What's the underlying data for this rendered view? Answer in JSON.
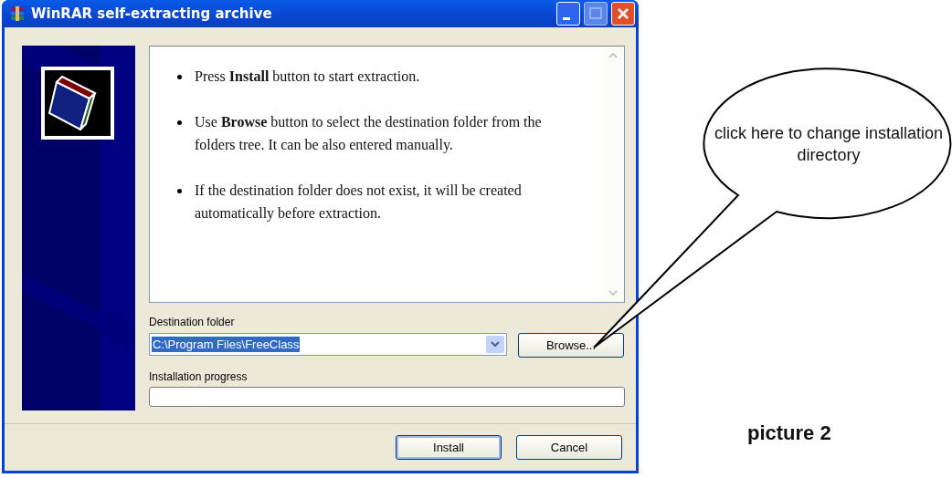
{
  "window": {
    "title": "WinRAR self-extracting archive"
  },
  "instructions": [
    {
      "text": "Press **Install** button to start extraction."
    },
    {
      "text": "Use **Browse** button to select the destination folder from the folders tree. It can be also entered manually."
    },
    {
      "text": "If the destination folder does not exist, it will be created automatically before extraction."
    }
  ],
  "destination": {
    "label": "Destination folder",
    "value": "C:\\Program Files\\FreeClass",
    "selected": true,
    "browse_button": "Browse..."
  },
  "progress": {
    "label": "Installation progress",
    "level": 0
  },
  "buttons": [
    {
      "label": "Install",
      "default": true
    },
    {
      "label": "Cancel",
      "default": false
    }
  ],
  "callout": {
    "text": "click here to change installation directory"
  },
  "caption": "picture 2"
}
